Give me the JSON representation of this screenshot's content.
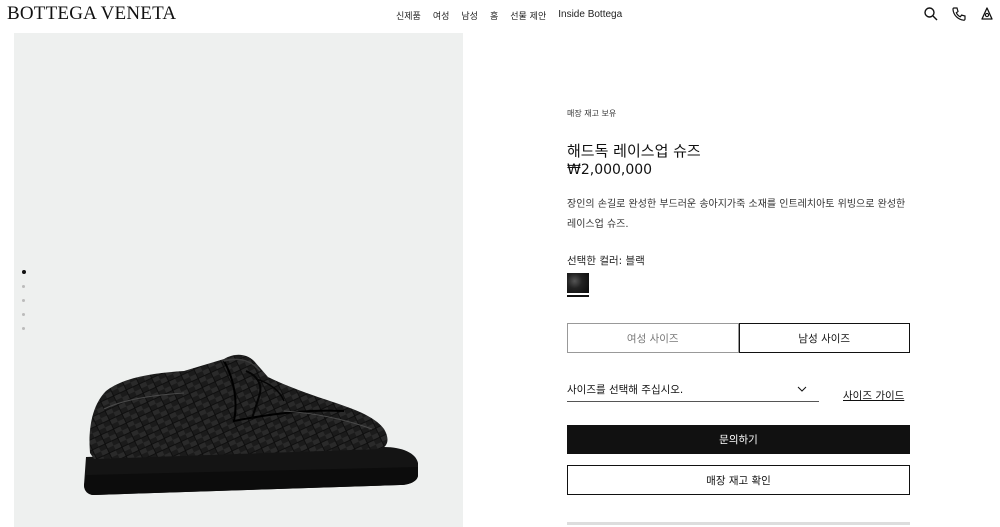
{
  "header": {
    "logo": "BOTTEGA VENETA",
    "nav": [
      "신제품",
      "여성",
      "남성",
      "홈",
      "선물 제안",
      "Inside Bottega"
    ],
    "icons": [
      "search-icon",
      "phone-icon",
      "account-icon"
    ]
  },
  "gallery": {
    "image_count": 5,
    "active_index": 0
  },
  "product": {
    "stock_note": "매장 재고 보유",
    "title": "해드독 레이스업 슈즈",
    "price": "₩2,000,000",
    "description": "장인의 손길로 완성한 부드러운 송아지가죽 소재를 인트레치아토 위빙으로 완성한 레이스업 슈즈.",
    "color_label": "선택한 컬러: 블랙",
    "size_tabs": [
      "여성 사이즈",
      "남성 사이즈"
    ],
    "selected_size_tab": "남성 사이즈",
    "size_placeholder": "사이즈를 선택해 주십시오.",
    "size_guide": "사이즈 가이드",
    "inquire_button": "문의하기",
    "store_stock_button": "매장 재고 확인"
  },
  "colors": {
    "accent": "#111111",
    "image_bg": "#eef0ef"
  }
}
